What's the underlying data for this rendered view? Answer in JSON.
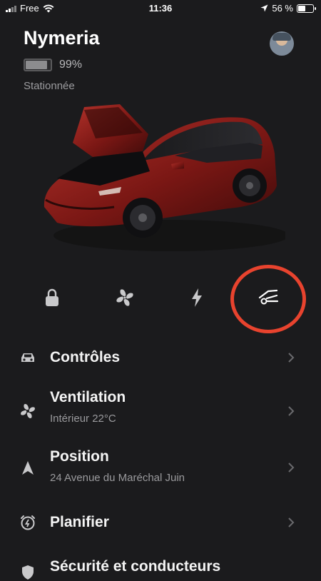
{
  "status_bar": {
    "carrier": "Free",
    "time": "11:36",
    "battery_percent": "56 %",
    "battery_level": 0.56
  },
  "vehicle": {
    "name": "Nymeria",
    "battery_text": "99%",
    "battery_level": 0.99,
    "status": "Stationnée",
    "color": "#8e1f1b"
  },
  "quick_actions": [
    {
      "icon": "lock-icon"
    },
    {
      "icon": "fan-icon"
    },
    {
      "icon": "bolt-icon"
    },
    {
      "icon": "frunk-icon",
      "highlighted": true
    }
  ],
  "highlight_color": "#e8432e",
  "menu": [
    {
      "icon": "car-icon",
      "title": "Contrôles",
      "subtitle": ""
    },
    {
      "icon": "fan-icon",
      "title": "Ventilation",
      "subtitle": "Intérieur 22°C"
    },
    {
      "icon": "navigation-arrow-icon",
      "title": "Position",
      "subtitle": "24 Avenue du Maréchal Juin"
    },
    {
      "icon": "alarm-clock-icon",
      "title": "Planifier",
      "subtitle": ""
    },
    {
      "icon": "shield-icon",
      "title": "Sécurité et conducteurs",
      "subtitle": ""
    }
  ]
}
